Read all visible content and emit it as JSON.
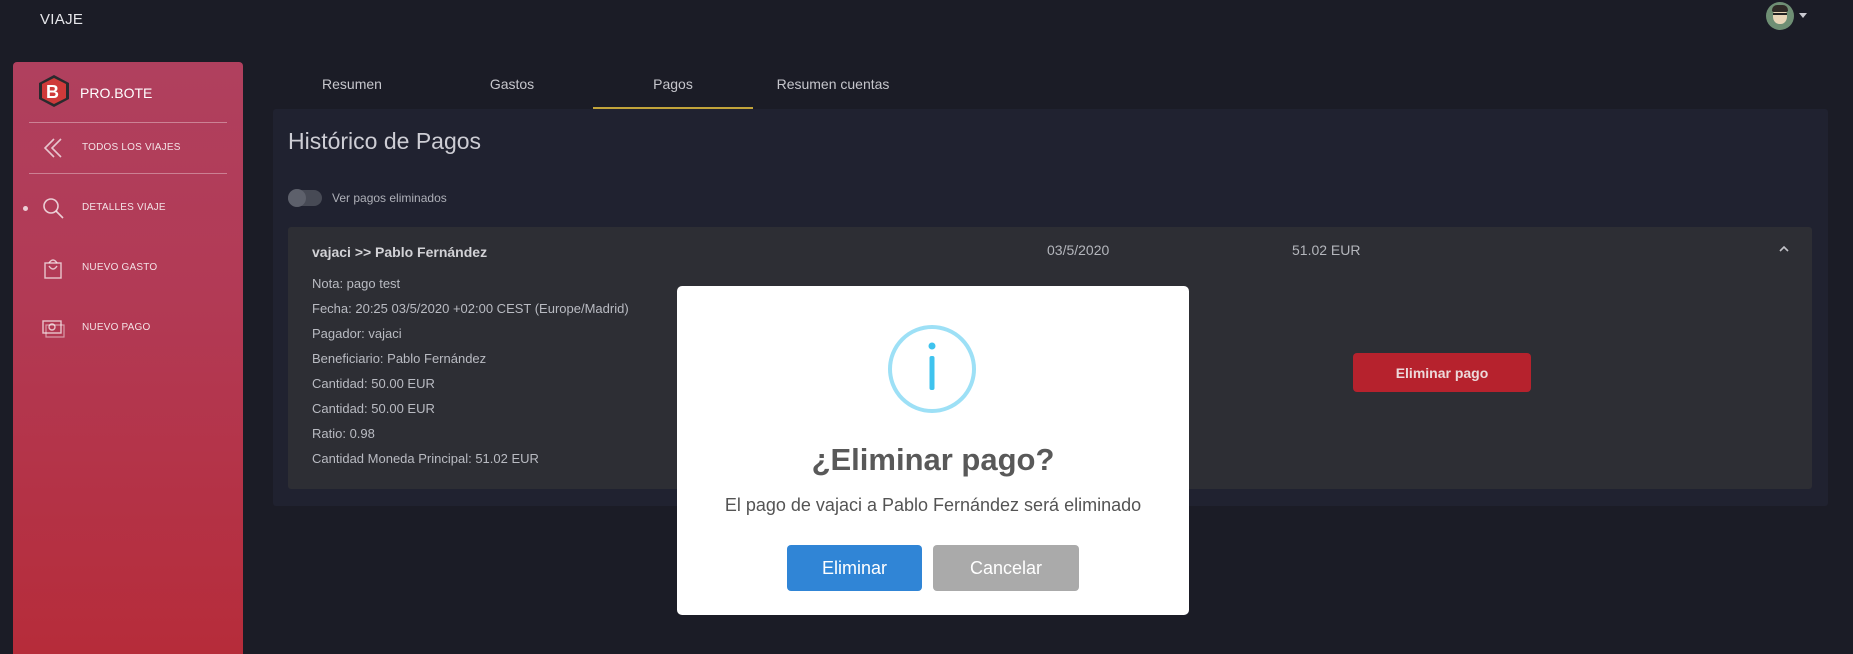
{
  "header": {
    "title": "VIAJE"
  },
  "sidebar": {
    "brand": "PRO.BOTE",
    "items": [
      {
        "label": "TODOS LOS VIAJES",
        "icon": "double-chevron-left-icon"
      },
      {
        "label": "DETALLES VIAJE",
        "icon": "search-icon",
        "active": true
      },
      {
        "label": "NUEVO GASTO",
        "icon": "shopping-bag-icon"
      },
      {
        "label": "NUEVO PAGO",
        "icon": "money-icon"
      }
    ]
  },
  "tabs": [
    {
      "label": "Resumen"
    },
    {
      "label": "Gastos"
    },
    {
      "label": "Pagos",
      "active": true
    },
    {
      "label": "Resumen cuentas"
    }
  ],
  "main": {
    "title": "Histórico de Pagos",
    "toggle_label": "Ver pagos eliminados",
    "payment": {
      "title": "vajaci >> Pablo Fernández",
      "date": "03/5/2020",
      "amount": "51.02 EUR",
      "details": [
        "Nota: pago test",
        "Fecha: 20:25 03/5/2020 +02:00 CEST (Europe/Madrid)",
        "Pagador: vajaci",
        "Beneficiario: Pablo Fernández",
        "Cantidad: 50.00 EUR",
        "Cantidad: 50.00 EUR",
        "Ratio: 0.98",
        "Cantidad Moneda Principal: 51.02 EUR"
      ],
      "delete_label": "Eliminar pago"
    }
  },
  "modal": {
    "title": "¿Eliminar pago?",
    "text": "El pago de vajaci a Pablo Fernández será eliminado",
    "confirm_label": "Eliminar",
    "cancel_label": "Cancelar"
  },
  "colors": {
    "accent_tab": "#c2a43a",
    "danger": "#b6222d",
    "confirm": "#3085d6",
    "cancel": "#aaaaaa",
    "info": "#9de0f6"
  }
}
